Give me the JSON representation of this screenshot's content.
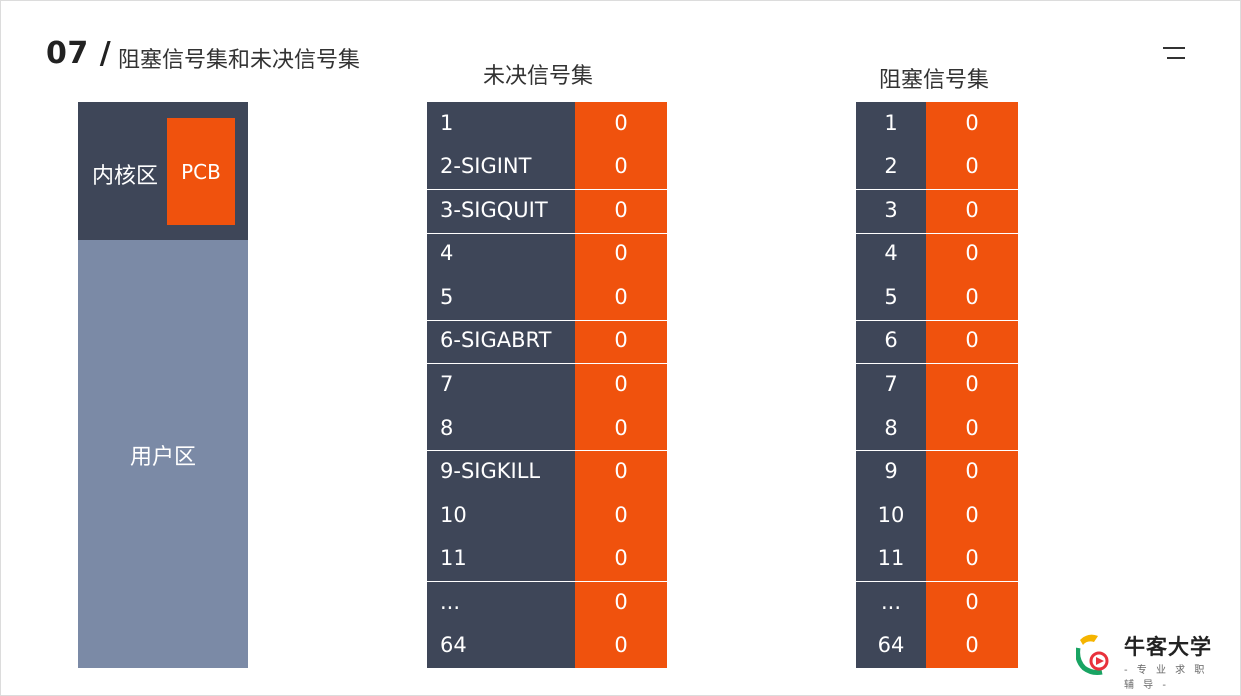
{
  "header": {
    "number": "07 /",
    "title": "阻塞信号集和未决信号集"
  },
  "memory": {
    "kernel_label": "内核区",
    "pcb_label": "PCB",
    "user_label": "用户区"
  },
  "pending": {
    "title": "未决信号集",
    "rows": [
      {
        "label": "1",
        "value": "0"
      },
      {
        "label": "2-SIGINT",
        "value": "0"
      },
      {
        "label": "3-SIGQUIT",
        "value": "0"
      },
      {
        "label": "4",
        "value": "0"
      },
      {
        "label": "5",
        "value": "0"
      },
      {
        "label": "6-SIGABRT",
        "value": "0"
      },
      {
        "label": "7",
        "value": "0"
      },
      {
        "label": "8",
        "value": "0"
      },
      {
        "label": "9-SIGKILL",
        "value": "0"
      },
      {
        "label": "10",
        "value": "0"
      },
      {
        "label": "11",
        "value": "0"
      },
      {
        "label": "...",
        "value": "0"
      },
      {
        "label": "64",
        "value": "0"
      }
    ]
  },
  "blocked": {
    "title": "阻塞信号集",
    "rows": [
      {
        "label": "1",
        "value": "0"
      },
      {
        "label": "2",
        "value": "0"
      },
      {
        "label": "3",
        "value": "0"
      },
      {
        "label": "4",
        "value": "0"
      },
      {
        "label": "5",
        "value": "0"
      },
      {
        "label": "6",
        "value": "0"
      },
      {
        "label": "7",
        "value": "0"
      },
      {
        "label": "8",
        "value": "0"
      },
      {
        "label": "9",
        "value": "0"
      },
      {
        "label": "10",
        "value": "0"
      },
      {
        "label": "11",
        "value": "0"
      },
      {
        "label": "...",
        "value": "0"
      },
      {
        "label": "64",
        "value": "0"
      }
    ]
  },
  "logo": {
    "name": "牛客大学",
    "tagline": "- 专 业 求 职 辅 导 -",
    "icon": "niuke-logo-icon"
  },
  "colors": {
    "dark": "#3e4658",
    "accent": "#f0520d",
    "user_area": "#7b8aa6"
  }
}
